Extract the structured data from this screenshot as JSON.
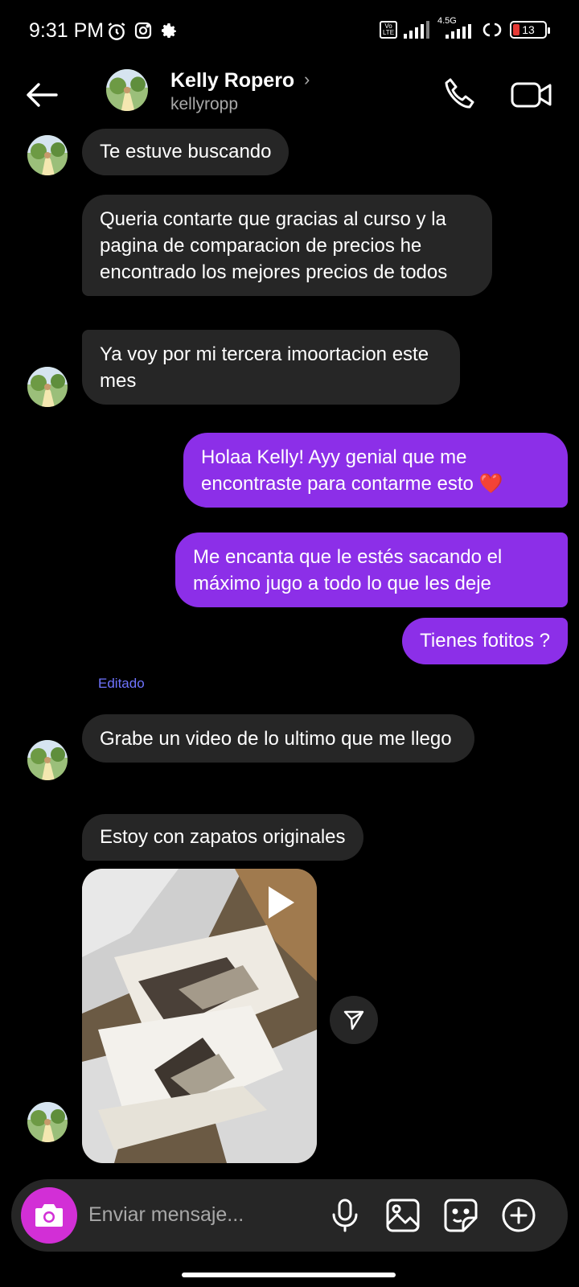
{
  "status_bar": {
    "time": "9:31 PM",
    "network": "4.5G",
    "volte": "Vo LTE",
    "battery": "13"
  },
  "header": {
    "name": "Kelly Ropero",
    "username": "kellyropp"
  },
  "messages": [
    {
      "direction": "in",
      "text": "Te estuve buscando"
    },
    {
      "direction": "in",
      "text": "Queria contarte que gracias al curso y la pagina de comparacion de precios he encontrado los mejores precios de todos"
    },
    {
      "direction": "in",
      "text": "Ya voy por mi tercera imoortacion este mes"
    },
    {
      "direction": "out",
      "text": "Holaa Kelly! Ayy genial que me encontraste para contarme esto ❤️"
    },
    {
      "direction": "out",
      "text": "Me encanta que le estés sacando el máximo jugo a todo lo que les deje"
    },
    {
      "direction": "out",
      "text": "Tienes fotitos ?"
    },
    {
      "direction": "in",
      "text": "Grabe un video de lo ultimo que me llego",
      "edited_label": "Editado"
    },
    {
      "direction": "in",
      "text": "Estoy con zapatos originales"
    }
  ],
  "composer": {
    "placeholder": "Enviar mensaje..."
  },
  "colors": {
    "outgoing_bubble": "#8c2fe8",
    "incoming_bubble": "#262626",
    "camera_button": "#d22fd6",
    "edited_label": "#6f74ff"
  },
  "icons": [
    "back-arrow-icon",
    "phone-icon",
    "video-camera-icon",
    "play-icon",
    "share-icon",
    "camera-icon",
    "microphone-icon",
    "gallery-icon",
    "sticker-icon",
    "plus-icon"
  ]
}
